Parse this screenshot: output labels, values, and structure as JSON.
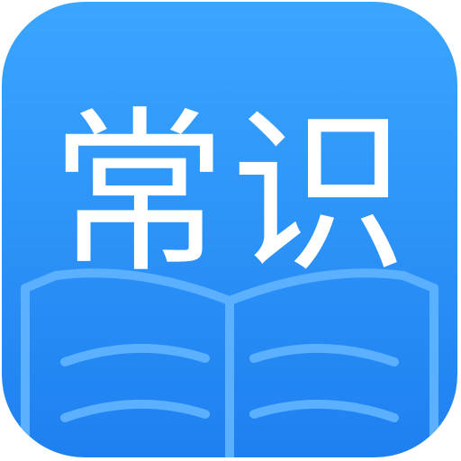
{
  "app_icon": {
    "title": "常识",
    "icon_name": "open-book-icon",
    "colors": {
      "background_top": "#3aa3ff",
      "background_bottom": "#1f7ff0",
      "book_lines": "#55aaff",
      "text": "#ffffff",
      "border": "#d0d4d8"
    }
  }
}
